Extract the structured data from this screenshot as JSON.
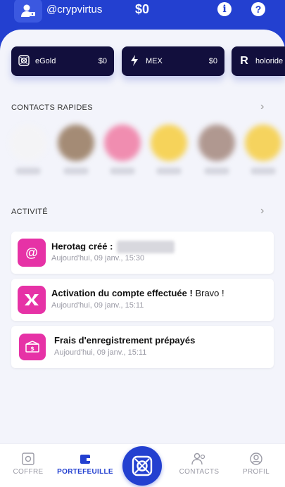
{
  "header": {
    "username": "@crypvirtus",
    "balance": "$0",
    "info_icon": "i",
    "help_icon": "?"
  },
  "tokens": [
    {
      "name": "eGold",
      "value": "$0",
      "icon": "egold-icon"
    },
    {
      "name": "MEX",
      "value": "$0",
      "icon": "bolt-icon"
    },
    {
      "name": "holoride",
      "value": "",
      "icon": "holoride-icon"
    }
  ],
  "contacts_section": {
    "title": "CONTACTS RAPIDES"
  },
  "contacts_colors": [
    "#f4f4f6",
    "#a48b75",
    "#f08db0",
    "#f6d35a",
    "#b09890",
    "#f5d35e"
  ],
  "activity_section": {
    "title": "ACTIVITÉ"
  },
  "activities": [
    {
      "title": "Herotag créé :",
      "extra": "",
      "time": "Aujourd'hui, 09 janv., 15:30",
      "icon": "at-icon"
    },
    {
      "title": "Activation du compte effectuée !",
      "extra": "Bravo !",
      "time": "Aujourd'hui, 09 janv., 15:11",
      "icon": "multiversx-icon"
    },
    {
      "title": "Frais d'enregistrement prépayés",
      "extra": "",
      "time": "Aujourd'hui, 09 janv., 15:11",
      "icon": "money-icon"
    }
  ],
  "nav": {
    "coffre": "COFFRE",
    "portefeuille": "PORTEFEUILLE",
    "contacts": "CONTACTS",
    "profil": "PROFIL"
  },
  "colors": {
    "primary": "#2340d0",
    "card_dark": "#120f3d",
    "activity_icon": "#e632a6"
  }
}
